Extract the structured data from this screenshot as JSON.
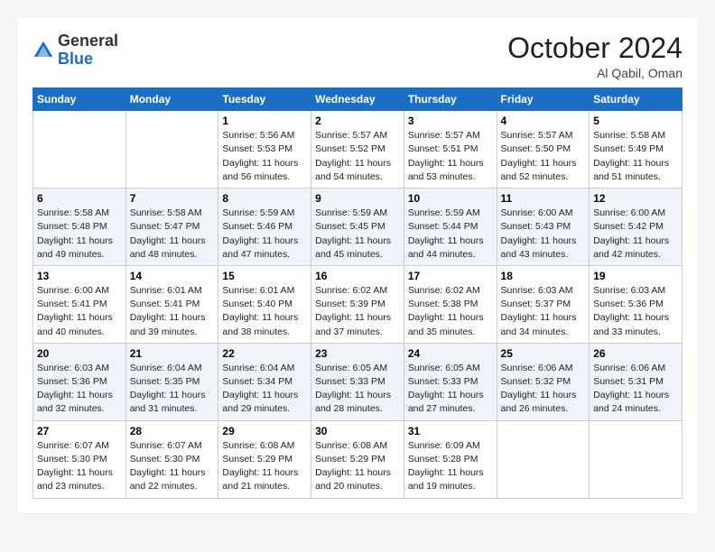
{
  "header": {
    "logo_general": "General",
    "logo_blue": "Blue",
    "month_title": "October 2024",
    "subtitle": "Al Qabil, Oman"
  },
  "weekdays": [
    "Sunday",
    "Monday",
    "Tuesday",
    "Wednesday",
    "Thursday",
    "Friday",
    "Saturday"
  ],
  "weeks": [
    [
      {
        "day": "",
        "info": ""
      },
      {
        "day": "",
        "info": ""
      },
      {
        "day": "1",
        "info": "Sunrise: 5:56 AM\nSunset: 5:53 PM\nDaylight: 11 hours and 56 minutes."
      },
      {
        "day": "2",
        "info": "Sunrise: 5:57 AM\nSunset: 5:52 PM\nDaylight: 11 hours and 54 minutes."
      },
      {
        "day": "3",
        "info": "Sunrise: 5:57 AM\nSunset: 5:51 PM\nDaylight: 11 hours and 53 minutes."
      },
      {
        "day": "4",
        "info": "Sunrise: 5:57 AM\nSunset: 5:50 PM\nDaylight: 11 hours and 52 minutes."
      },
      {
        "day": "5",
        "info": "Sunrise: 5:58 AM\nSunset: 5:49 PM\nDaylight: 11 hours and 51 minutes."
      }
    ],
    [
      {
        "day": "6",
        "info": "Sunrise: 5:58 AM\nSunset: 5:48 PM\nDaylight: 11 hours and 49 minutes."
      },
      {
        "day": "7",
        "info": "Sunrise: 5:58 AM\nSunset: 5:47 PM\nDaylight: 11 hours and 48 minutes."
      },
      {
        "day": "8",
        "info": "Sunrise: 5:59 AM\nSunset: 5:46 PM\nDaylight: 11 hours and 47 minutes."
      },
      {
        "day": "9",
        "info": "Sunrise: 5:59 AM\nSunset: 5:45 PM\nDaylight: 11 hours and 45 minutes."
      },
      {
        "day": "10",
        "info": "Sunrise: 5:59 AM\nSunset: 5:44 PM\nDaylight: 11 hours and 44 minutes."
      },
      {
        "day": "11",
        "info": "Sunrise: 6:00 AM\nSunset: 5:43 PM\nDaylight: 11 hours and 43 minutes."
      },
      {
        "day": "12",
        "info": "Sunrise: 6:00 AM\nSunset: 5:42 PM\nDaylight: 11 hours and 42 minutes."
      }
    ],
    [
      {
        "day": "13",
        "info": "Sunrise: 6:00 AM\nSunset: 5:41 PM\nDaylight: 11 hours and 40 minutes."
      },
      {
        "day": "14",
        "info": "Sunrise: 6:01 AM\nSunset: 5:41 PM\nDaylight: 11 hours and 39 minutes."
      },
      {
        "day": "15",
        "info": "Sunrise: 6:01 AM\nSunset: 5:40 PM\nDaylight: 11 hours and 38 minutes."
      },
      {
        "day": "16",
        "info": "Sunrise: 6:02 AM\nSunset: 5:39 PM\nDaylight: 11 hours and 37 minutes."
      },
      {
        "day": "17",
        "info": "Sunrise: 6:02 AM\nSunset: 5:38 PM\nDaylight: 11 hours and 35 minutes."
      },
      {
        "day": "18",
        "info": "Sunrise: 6:03 AM\nSunset: 5:37 PM\nDaylight: 11 hours and 34 minutes."
      },
      {
        "day": "19",
        "info": "Sunrise: 6:03 AM\nSunset: 5:36 PM\nDaylight: 11 hours and 33 minutes."
      }
    ],
    [
      {
        "day": "20",
        "info": "Sunrise: 6:03 AM\nSunset: 5:36 PM\nDaylight: 11 hours and 32 minutes."
      },
      {
        "day": "21",
        "info": "Sunrise: 6:04 AM\nSunset: 5:35 PM\nDaylight: 11 hours and 31 minutes."
      },
      {
        "day": "22",
        "info": "Sunrise: 6:04 AM\nSunset: 5:34 PM\nDaylight: 11 hours and 29 minutes."
      },
      {
        "day": "23",
        "info": "Sunrise: 6:05 AM\nSunset: 5:33 PM\nDaylight: 11 hours and 28 minutes."
      },
      {
        "day": "24",
        "info": "Sunrise: 6:05 AM\nSunset: 5:33 PM\nDaylight: 11 hours and 27 minutes."
      },
      {
        "day": "25",
        "info": "Sunrise: 6:06 AM\nSunset: 5:32 PM\nDaylight: 11 hours and 26 minutes."
      },
      {
        "day": "26",
        "info": "Sunrise: 6:06 AM\nSunset: 5:31 PM\nDaylight: 11 hours and 24 minutes."
      }
    ],
    [
      {
        "day": "27",
        "info": "Sunrise: 6:07 AM\nSunset: 5:30 PM\nDaylight: 11 hours and 23 minutes."
      },
      {
        "day": "28",
        "info": "Sunrise: 6:07 AM\nSunset: 5:30 PM\nDaylight: 11 hours and 22 minutes."
      },
      {
        "day": "29",
        "info": "Sunrise: 6:08 AM\nSunset: 5:29 PM\nDaylight: 11 hours and 21 minutes."
      },
      {
        "day": "30",
        "info": "Sunrise: 6:08 AM\nSunset: 5:29 PM\nDaylight: 11 hours and 20 minutes."
      },
      {
        "day": "31",
        "info": "Sunrise: 6:09 AM\nSunset: 5:28 PM\nDaylight: 11 hours and 19 minutes."
      },
      {
        "day": "",
        "info": ""
      },
      {
        "day": "",
        "info": ""
      }
    ]
  ]
}
